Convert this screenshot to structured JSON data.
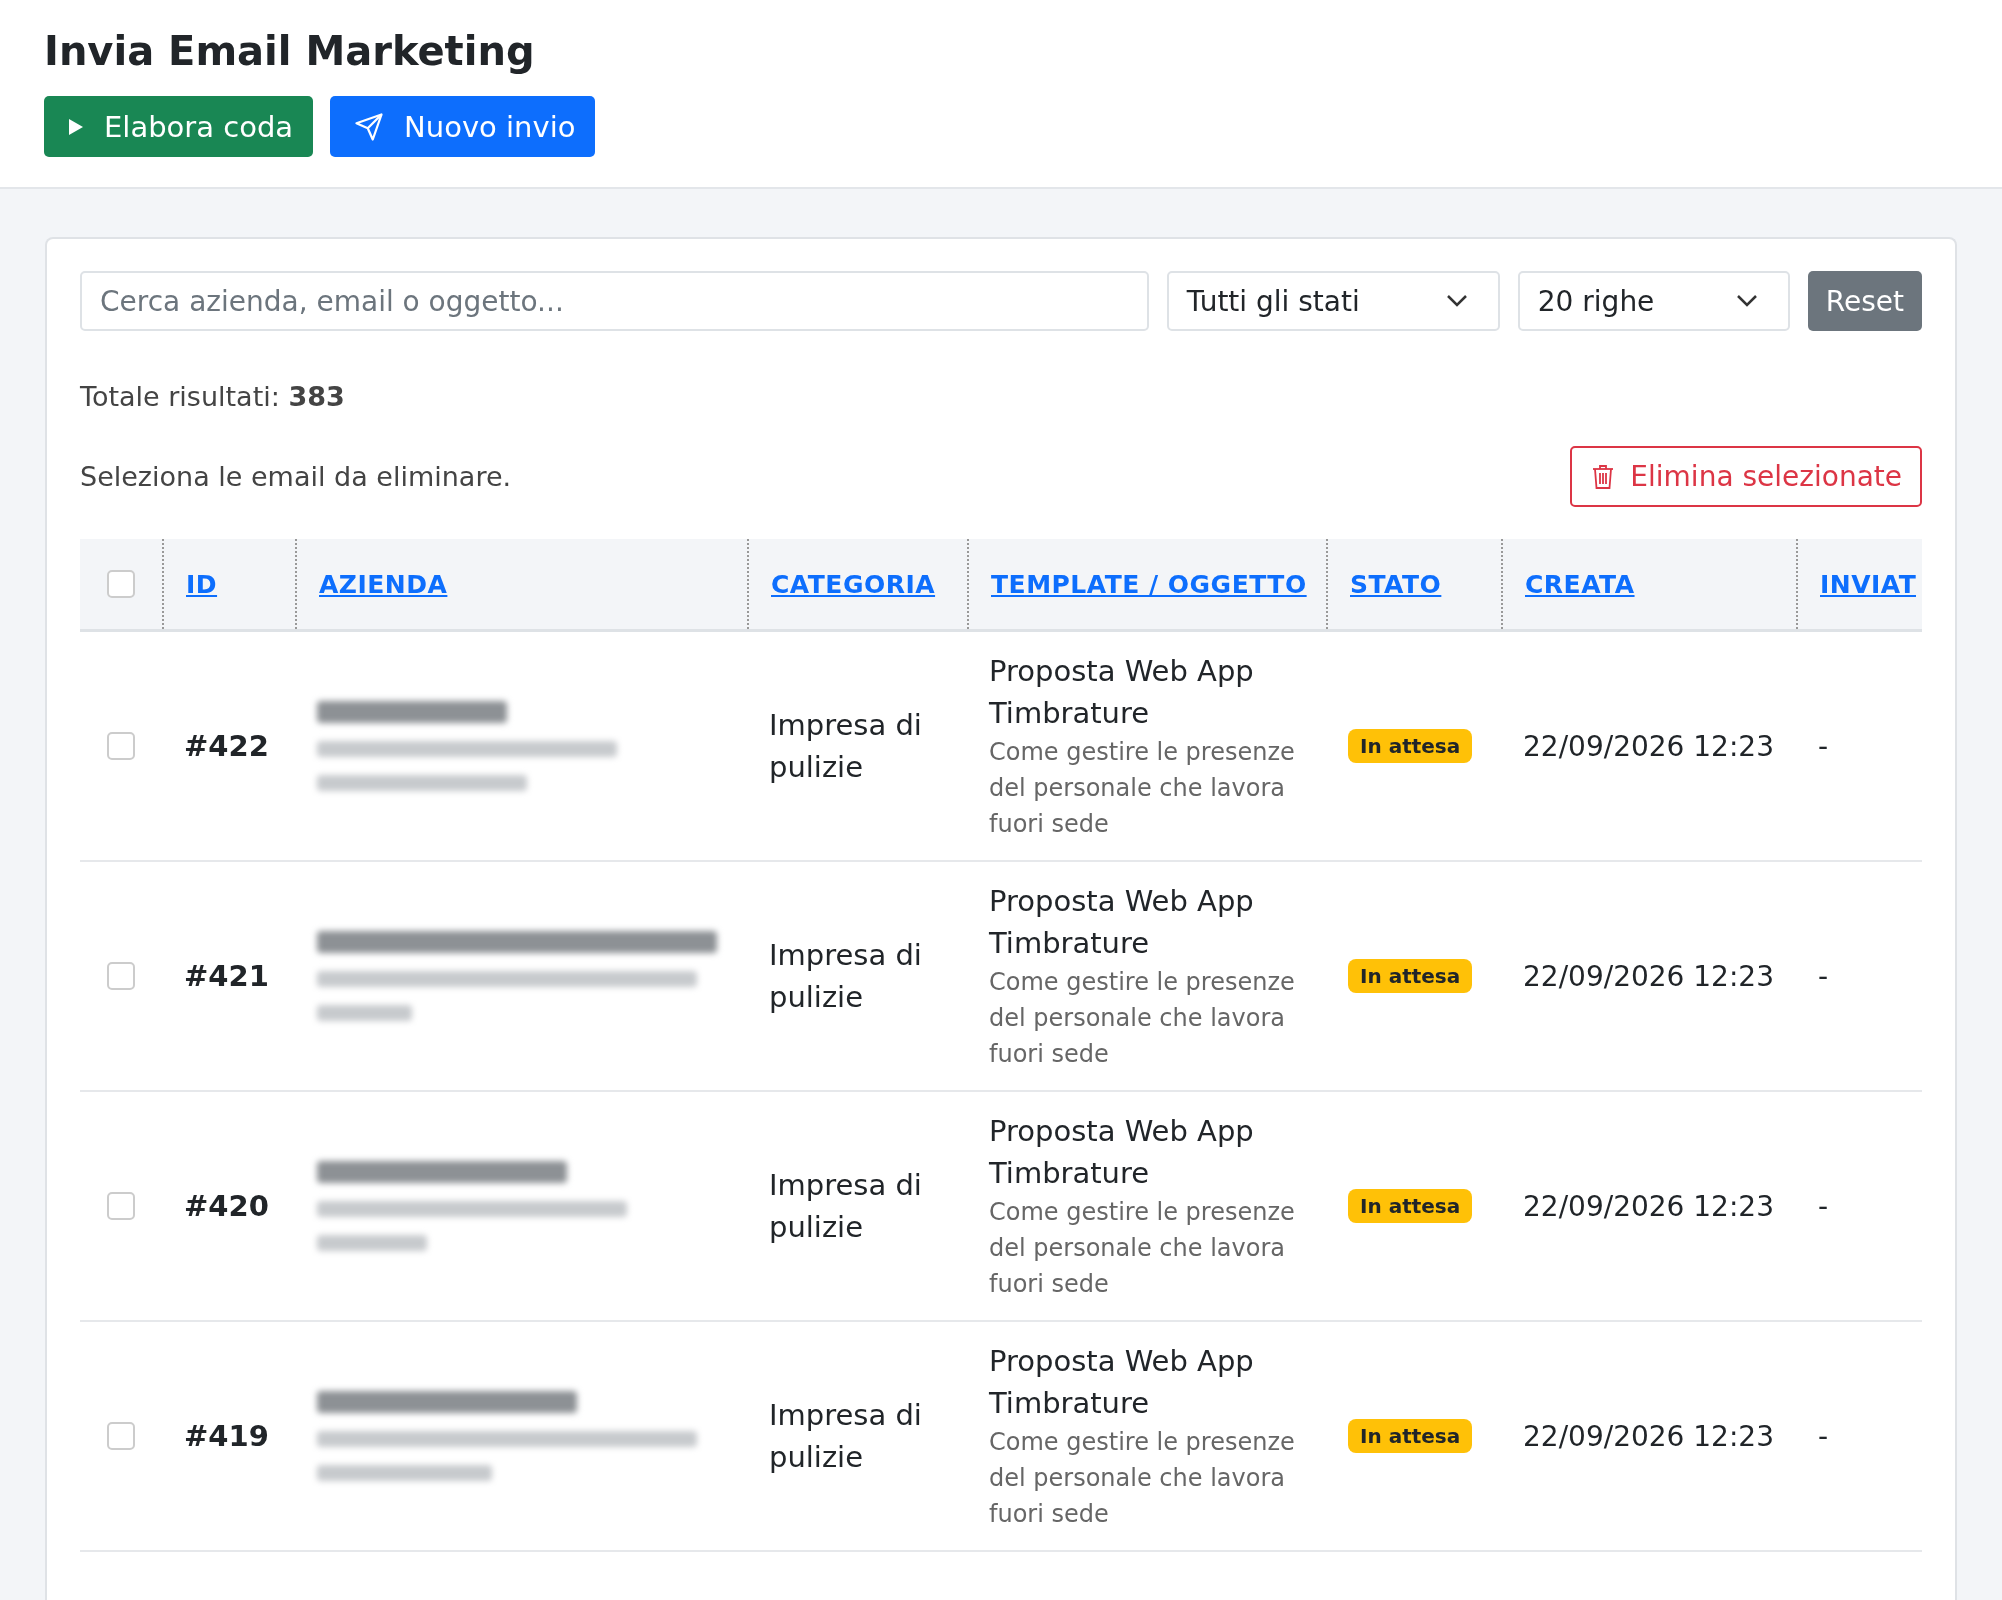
{
  "title": "Invia Email Marketing",
  "actions": [
    {
      "kind": "play",
      "label": "Elabora coda"
    },
    {
      "kind": "send",
      "label": "Nuovo invio"
    }
  ],
  "filters": {
    "search": {
      "placeholder": "Cerca azienda, email o oggetto..."
    },
    "status_select": "Tutti gli stati",
    "rows_select": "20 righe",
    "reset": "Reset"
  },
  "total": {
    "label": "Totale risultati:",
    "value": "383"
  },
  "selection_hint": "Seleziona le email da eliminare.",
  "delete_button": "Elimina selezionate",
  "table": {
    "select_all_checked": false,
    "columns": [
      "ID",
      "AZIENDA",
      "CATEGORIA",
      "TEMPLATE / OGGETTO",
      "STATO",
      "CREATA",
      "INVIAT"
    ],
    "rows": [
      {
        "checked": false,
        "id": "#422",
        "category": "Impresa di pulizie",
        "template": "Proposta Web App Timbrature",
        "subject": "Come gestire le presenze del personale che lavora fuori sede",
        "status": "In attesa",
        "created": "22/09/2026 12:23",
        "sent": "-"
      },
      {
        "checked": false,
        "id": "#421",
        "category": "Impresa di pulizie",
        "template": "Proposta Web App Timbrature",
        "subject": "Come gestire le presenze del personale che lavora fuori sede",
        "status": "In attesa",
        "created": "22/09/2026 12:23",
        "sent": "-"
      },
      {
        "checked": false,
        "id": "#420",
        "category": "Impresa di pulizie",
        "template": "Proposta Web App Timbrature",
        "subject": "Come gestire le presenze del personale che lavora fuori sede",
        "status": "In attesa",
        "created": "22/09/2026 12:23",
        "sent": "-"
      },
      {
        "checked": false,
        "id": "#419",
        "category": "Impresa di pulizie",
        "template": "Proposta Web App Timbrature",
        "subject": "Come gestire le presenze del personale che lavora fuori sede",
        "status": "In attesa",
        "created": "22/09/2026 12:23",
        "sent": "-"
      }
    ]
  }
}
